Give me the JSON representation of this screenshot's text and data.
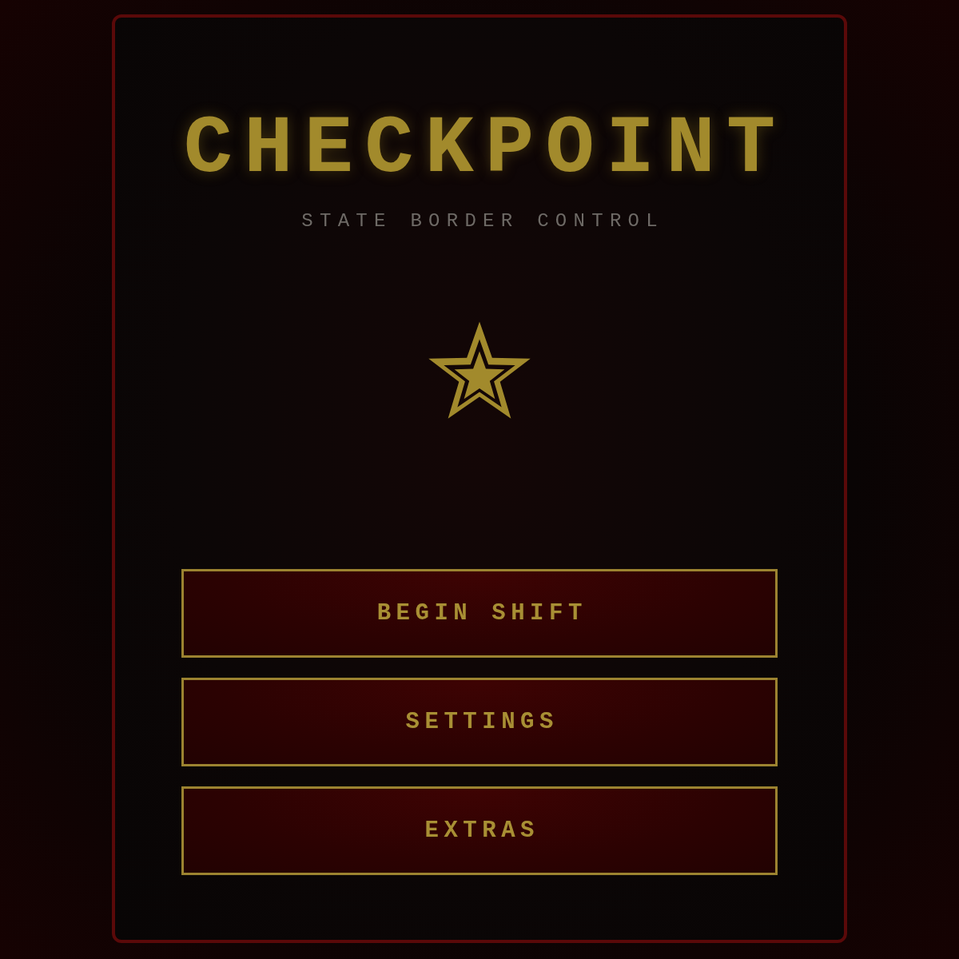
{
  "title": "CHECKPOINT",
  "subtitle": "STATE BORDER CONTROL",
  "menu": [
    {
      "label": "BEGIN SHIFT"
    },
    {
      "label": "SETTINGS"
    },
    {
      "label": "EXTRAS"
    }
  ]
}
